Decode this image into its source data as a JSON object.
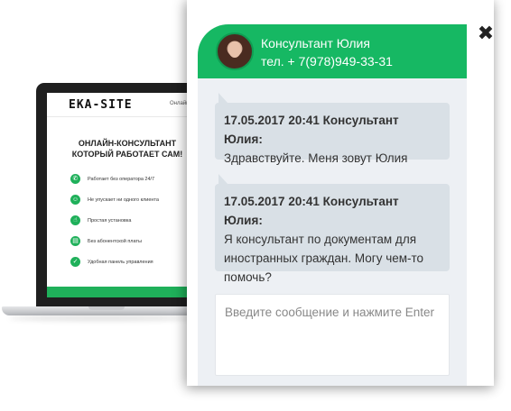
{
  "laptop_site": {
    "logo": "EKA-SITE",
    "nav_link": "Онлайн",
    "headline_line1": "Онлайн-консультант",
    "headline_line2": "который работает сам!",
    "features": [
      {
        "icon": "chat-icon",
        "text": "Работает без оператора 24/7"
      },
      {
        "icon": "users-icon",
        "text": "Не упускает ни одного клиента"
      },
      {
        "icon": "pointer-icon",
        "text": "Простая установка"
      },
      {
        "icon": "wallet-icon",
        "text": "Без абонентской платы"
      },
      {
        "icon": "thumbs-up-icon",
        "text": "Удобная панель управления"
      }
    ]
  },
  "chat": {
    "agent_name": "Консультант Юлия",
    "agent_phone": "тел. + 7(978)949-33-31",
    "close_icon": "close-icon",
    "messages": [
      {
        "meta": "17.05.2017 20:41 Консультант Юлия:",
        "text": "Здравствуйте. Меня зовут Юлия"
      },
      {
        "meta": "17.05.2017 20:41 Консультант Юлия:",
        "text": "Я консультант по документам для иностранных граждан. Могу чем-то помочь?"
      }
    ],
    "input_placeholder": "Введите сообщение и нажмите Enter"
  },
  "colors": {
    "accent_green": "#16b863",
    "site_green": "#1fb05a",
    "bubble_bg": "#d9e0e6",
    "body_bg": "#edf0f4"
  }
}
